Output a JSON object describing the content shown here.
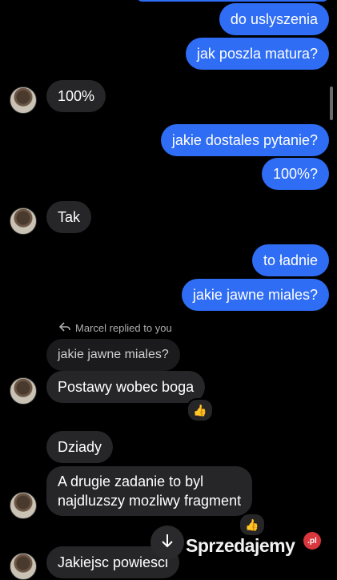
{
  "messages": {
    "m1": "do uslyszenia",
    "m2": "jak poszla matura?",
    "m3": "100%",
    "m4": "jakie dostales pytanie?",
    "m5": "100%?",
    "m6": "Tak",
    "m7": "to ładnie",
    "m8": "jakie jawne miales?",
    "reply_label": "Marcel replied to you",
    "quoted": "jakie jawne miales?",
    "m9": "Postawy wobec boga",
    "m10": "Dziady",
    "m11_line1": "A drugie zadanie to byl",
    "m11_line2": "najdluzszy mozliwy fragment",
    "m12": "Jakiejsc powiesci"
  },
  "reactions": {
    "r1": "👍",
    "r2": "👍"
  },
  "watermark": {
    "text": "Sprzedajemy",
    "badge": ".pl"
  },
  "colors": {
    "outgoing": "#2f6df5",
    "incoming": "#262629",
    "background": "#000000"
  },
  "icons": [
    "reply-arrow-icon",
    "down-arrow-icon",
    "thumbs-up-icon"
  ]
}
